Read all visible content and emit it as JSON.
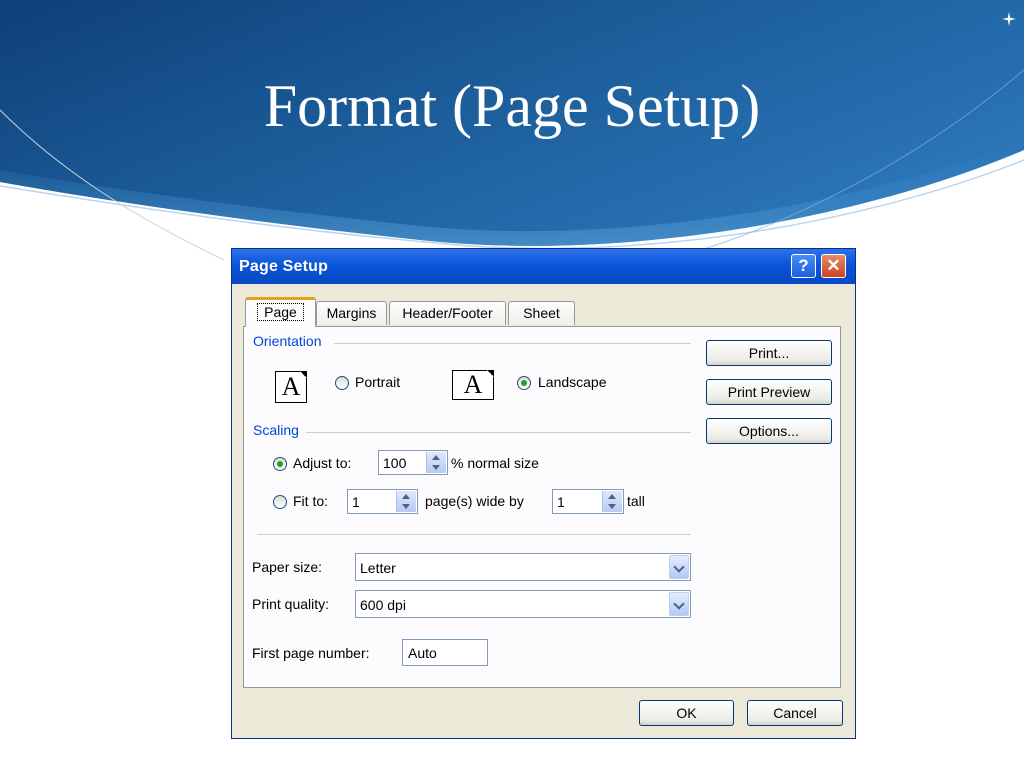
{
  "slide": {
    "title": "Format (Page Setup)"
  },
  "dialog": {
    "title": "Page Setup",
    "help_label": "?",
    "close_label": "✕",
    "tabs": [
      {
        "label": "Page"
      },
      {
        "label": "Margins"
      },
      {
        "label": "Header/Footer"
      },
      {
        "label": "Sheet"
      }
    ],
    "orientation": {
      "group_label": "Orientation",
      "icon_letter": "A",
      "portrait_label": "Portrait",
      "landscape_label": "Landscape",
      "selected": "Landscape"
    },
    "scaling": {
      "group_label": "Scaling",
      "adjust_label": "Adjust to:",
      "adjust_value": "100",
      "adjust_suffix": "% normal size",
      "fit_label": "Fit to:",
      "fit_wide_value": "1",
      "fit_middle_label": "page(s) wide by",
      "fit_tall_value": "1",
      "fit_tall_label": "tall",
      "selected": "Adjust to"
    },
    "paper_size": {
      "label": "Paper size:",
      "value": "Letter"
    },
    "print_quality": {
      "label": "Print quality:",
      "value": "600 dpi"
    },
    "first_page_number": {
      "label": "First page number:",
      "value": "Auto"
    },
    "side_buttons": {
      "print": "Print...",
      "print_preview": "Print Preview",
      "options": "Options..."
    },
    "footer_buttons": {
      "ok": "OK",
      "cancel": "Cancel"
    }
  },
  "colors": {
    "slide_blue": "#1a5a96",
    "titlebar_blue": "#0b55d8",
    "group_label_blue": "#0046d5",
    "dialog_bg": "#ece9d8",
    "active_tab_accent": "#e6a21c"
  }
}
